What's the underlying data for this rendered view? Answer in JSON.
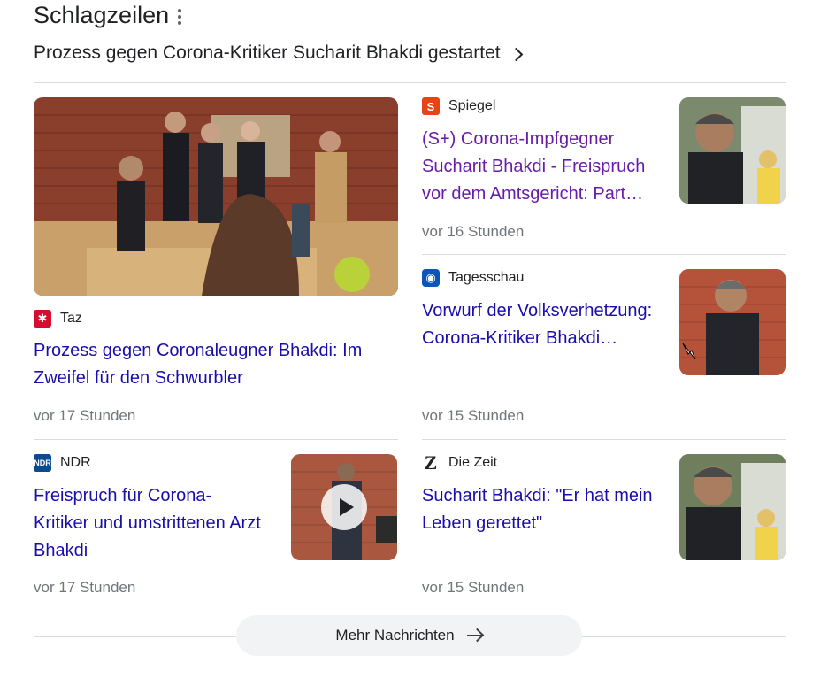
{
  "section": {
    "title": "Schlagzeilen"
  },
  "topic": {
    "title": "Prozess gegen Corona-Kritiker Sucharit Bhakdi gestartet"
  },
  "articles": [
    {
      "source": "Taz",
      "logo_color": "#d50d2e",
      "headline": "Prozess gegen Coronaleugner Bhakdi: Im Zweifel für den Schwurbler",
      "time": "vor 17 Stunden",
      "visited": false
    },
    {
      "source": "Spiegel",
      "logo_color": "#e64415",
      "headline": "(S+) Corona-Impfgegner Sucharit Bhakdi - Freispruch vor dem Amtsgericht: Part…",
      "time": "vor 16 Stunden",
      "visited": true
    },
    {
      "source": "Tagesschau",
      "logo_color": "#0a55b8",
      "headline": "Vorwurf der Volksverhetzung: Corona-Kritiker Bhakdi…",
      "time": "vor 15 Stunden",
      "visited": false
    },
    {
      "source": "NDR",
      "logo_color": "#0c4b8f",
      "headline": "Freispruch für Corona-Kritiker und umstrittenen Arzt Bhakdi",
      "time": "vor 17 Stunden",
      "visited": false,
      "video": true
    },
    {
      "source": "Die Zeit",
      "logo_color": "#202124",
      "headline": "Sucharit Bhakdi: \"Er hat mein Leben gerettet\"",
      "time": "vor 15 Stunden",
      "visited": false
    }
  ],
  "more_button": {
    "label": "Mehr Nachrichten"
  },
  "colors": {
    "link": "#1a0dab",
    "visited": "#681da8",
    "meta": "#70757a",
    "divider": "#dadce0"
  }
}
